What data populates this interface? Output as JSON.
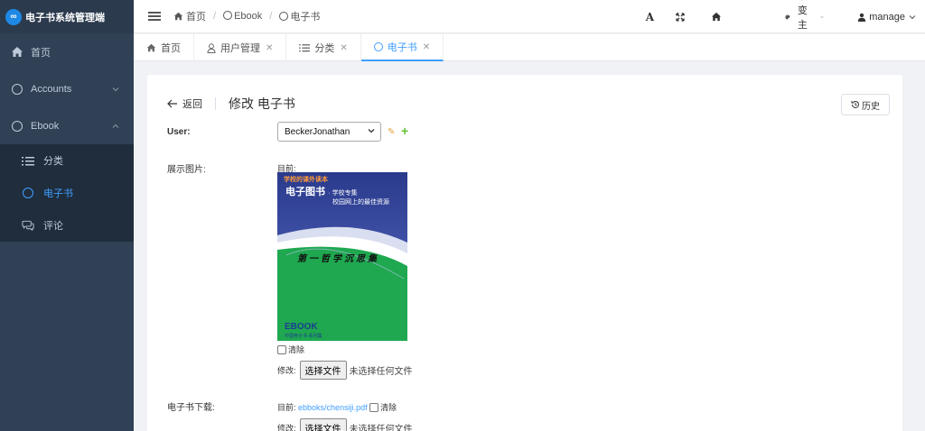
{
  "app": {
    "title": "电子书系统管理端",
    "logo_glyph": "∞"
  },
  "sidebar": {
    "items": [
      {
        "label": "首页",
        "icon": "home-icon"
      },
      {
        "label": "Accounts",
        "icon": "circle-icon"
      },
      {
        "label": "Ebook",
        "icon": "circle-icon"
      }
    ],
    "ebook_children": [
      {
        "label": "分类",
        "icon": "list-icon"
      },
      {
        "label": "电子书",
        "icon": "circle-icon"
      },
      {
        "label": "评论",
        "icon": "comment-icon"
      }
    ]
  },
  "breadcrumb": [
    "首页",
    "Ebook",
    "电子书"
  ],
  "topbar": {
    "font_glyph": "A",
    "theme_label": "改变主题",
    "user_label": "manage"
  },
  "tabs": [
    {
      "label": "首页"
    },
    {
      "label": "用户管理"
    },
    {
      "label": "分类"
    },
    {
      "label": "电子书"
    }
  ],
  "page": {
    "back_label": "返回",
    "title": "修改 电子书",
    "history_label": "历史"
  },
  "form": {
    "user_label": "User:",
    "user_value": "BeckerJonathan",
    "image_label": "展示图片:",
    "current_label": "目前:",
    "clear_label": "清除",
    "change_label": "修改:",
    "choose_file": "选择文件",
    "no_file": "未选择任何文件",
    "download_label": "电子书下载:",
    "download_current": "目前:",
    "download_link": "ebboks/chensiji.pdf"
  },
  "cover": {
    "top_tag": "学校的课外读本",
    "title": "电子图书",
    "subtitle": "· 学校专集",
    "tagline": "校园网上的最佳资源",
    "book_name": "第一哲学沉思集",
    "logo": "EBOOK",
    "logo_sub": "中国电子书·系列集"
  }
}
